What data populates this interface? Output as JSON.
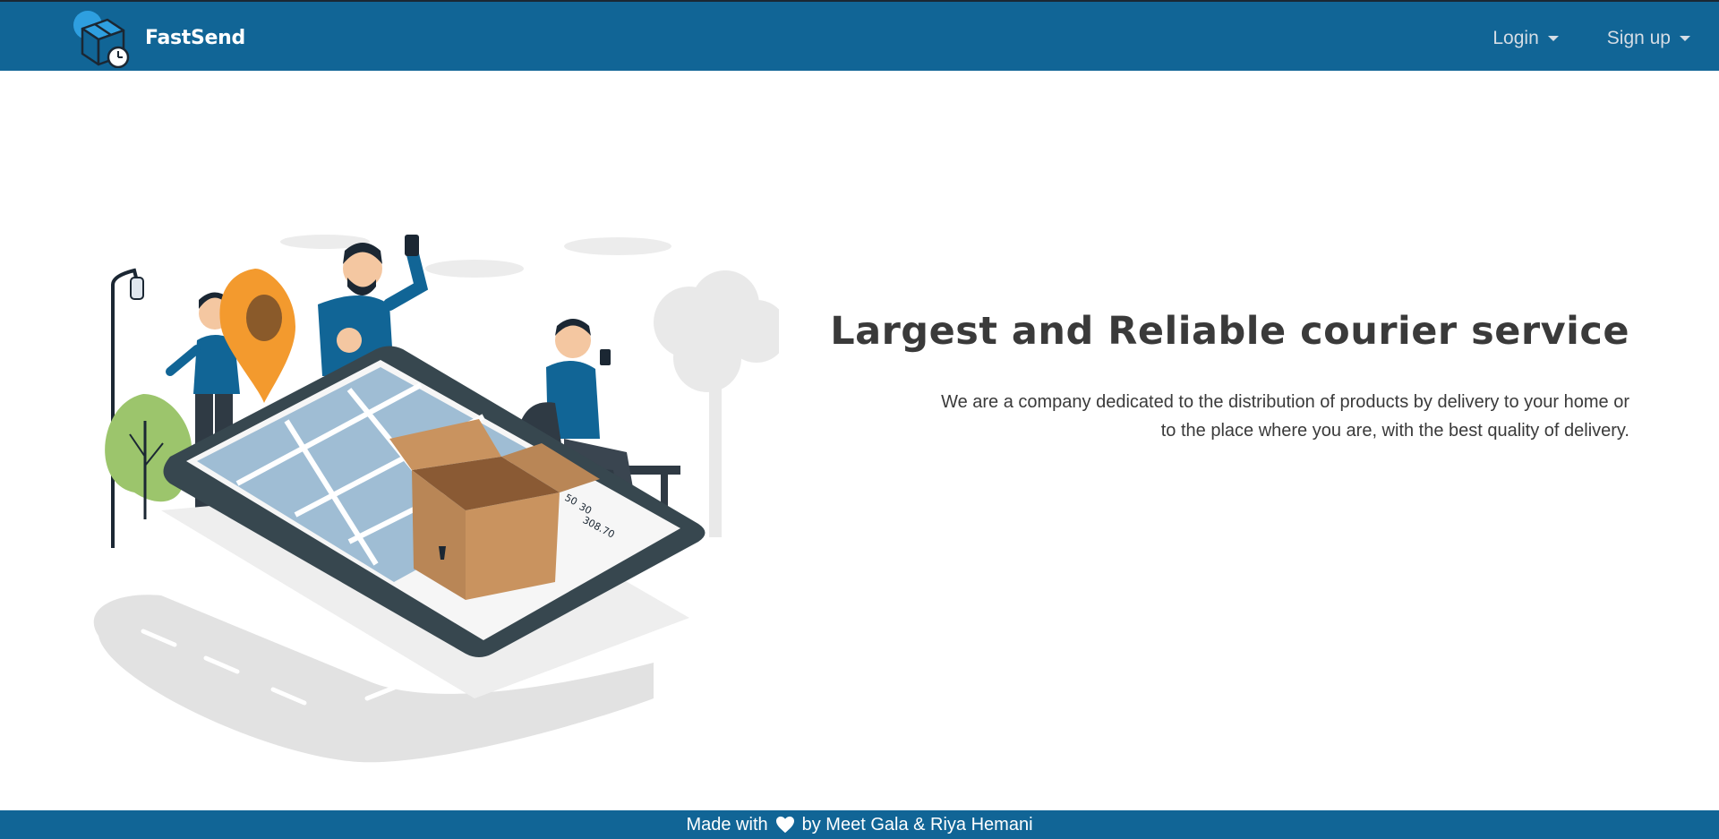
{
  "brand": {
    "name": "FastSend",
    "logo_icon": "package-clock-icon"
  },
  "nav": {
    "items": [
      {
        "label": "Login",
        "icon": "caret-down-icon"
      },
      {
        "label": "Sign up",
        "icon": "caret-down-icon"
      }
    ]
  },
  "hero": {
    "title": "Largest and Reliable courier service",
    "description_line1": "We are a company dedicated to the distribution of products by delivery to your home or",
    "description_line2": "to the place where you are, with the best quality of delivery.",
    "illustration": "delivery-people-phone-map-illustration",
    "phone_numbers": [
      "50",
      "30",
      "308.70"
    ]
  },
  "footer": {
    "prefix": "Made with",
    "heart_icon": "heart-icon",
    "suffix": "by Meet Gala & Riya Hemani"
  },
  "colors": {
    "primary": "#116596",
    "text": "#3a3a3a",
    "nav_text": "#d5dde5"
  }
}
